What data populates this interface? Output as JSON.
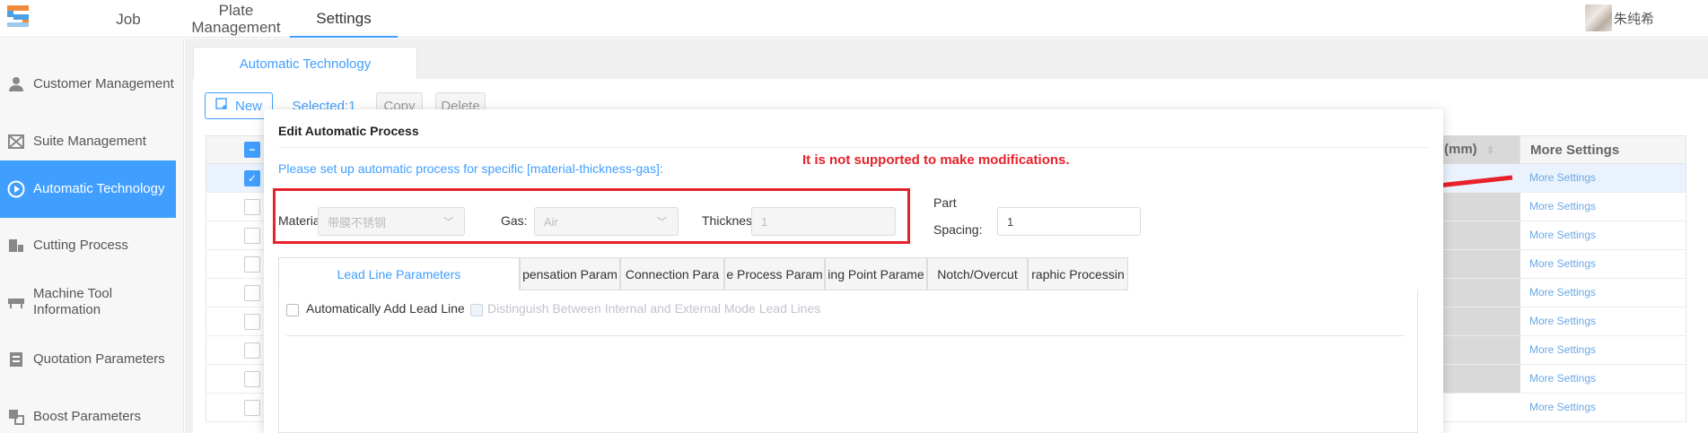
{
  "topnav": {
    "items": [
      {
        "label": "Job"
      },
      {
        "label": "Plate Management"
      },
      {
        "label": "Settings"
      }
    ],
    "user_name": "朱纯希"
  },
  "sidebar": {
    "items": [
      {
        "label": "Customer Management",
        "icon": "user-icon"
      },
      {
        "label": "Suite Management",
        "icon": "suite-icon"
      },
      {
        "label": "Automatic Technology",
        "icon": "play-circle-icon"
      },
      {
        "label": "Cutting Process",
        "icon": "cut-icon"
      },
      {
        "label": "Machine Tool Information",
        "icon": "machine-icon"
      },
      {
        "label": "Quotation Parameters",
        "icon": "quote-icon"
      },
      {
        "label": "Boost Parameters",
        "icon": "boost-icon"
      }
    ]
  },
  "main": {
    "tab_label": "Automatic Technology",
    "toolbar": {
      "new_label": "New",
      "selected_label": "Selected:1",
      "copy_label": "Copy",
      "delete_label": "Delete"
    },
    "table": {
      "partial_header": "(mm)",
      "more_header": "More Settings",
      "more_link": "More Settings",
      "row_count": 9
    }
  },
  "dialog": {
    "title": "Edit Automatic Process",
    "hint": "Please set up automatic process for specific [material-thickness-gas]:",
    "warning": "It is not supported to make modifications.",
    "fields": {
      "material_label": "Material",
      "material_value": "带膜不锈钢",
      "gas_label": "Gas:",
      "gas_value": "Air",
      "thickness_label": "Thicknes",
      "thickness_value": "1",
      "spacing_label_1": "Part",
      "spacing_label_2": "Spacing:",
      "spacing_value": "1"
    },
    "tabs": [
      "Lead Line Parameters",
      "pensation Param",
      "Connection Para",
      "e Process Param",
      "ing Point Parame",
      "Notch/Overcut",
      "raphic Processin"
    ],
    "options": {
      "auto_lead": "Automatically Add Lead Line",
      "distinguish": "Distinguish Between Internal and External Mode Lead Lines"
    }
  },
  "colors": {
    "accent": "#409eff",
    "warning": "#e8212b"
  }
}
